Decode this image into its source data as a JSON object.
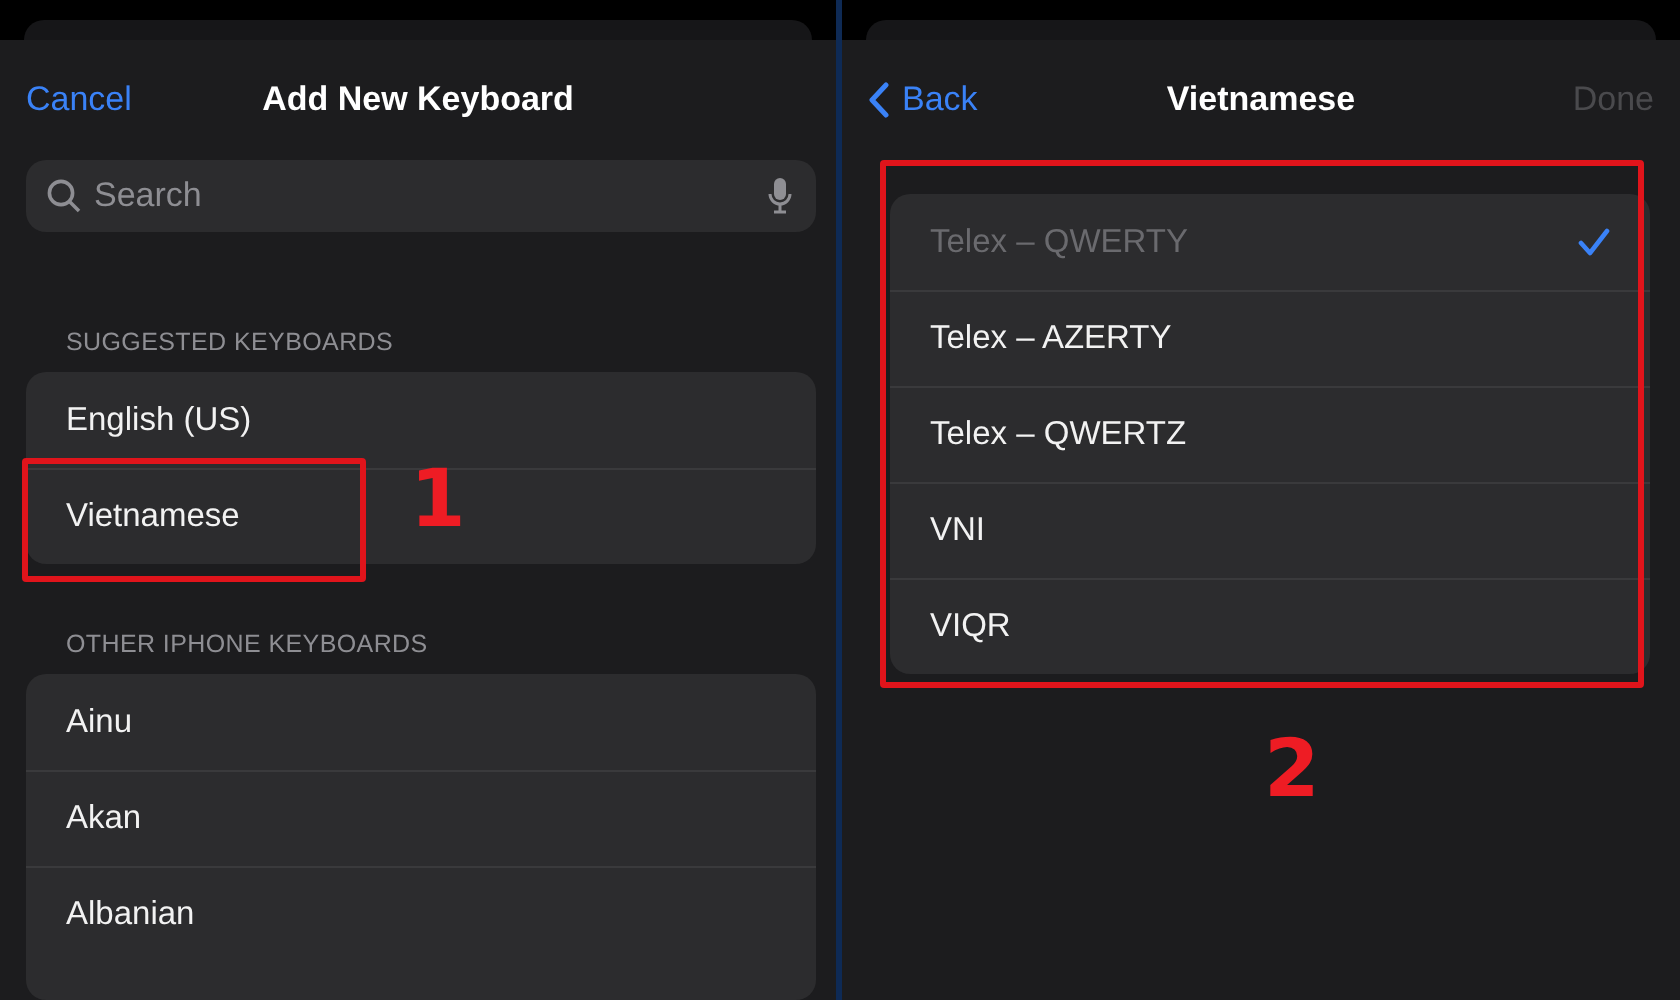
{
  "left": {
    "nav": {
      "cancel": "Cancel",
      "title": "Add New Keyboard"
    },
    "search": {
      "placeholder": "Search"
    },
    "sections": [
      {
        "header": "SUGGESTED KEYBOARDS",
        "items": [
          {
            "label": "English (US)",
            "highlighted": false
          },
          {
            "label": "Vietnamese",
            "highlighted": true
          }
        ]
      },
      {
        "header": "OTHER IPHONE KEYBOARDS",
        "items": [
          {
            "label": "Ainu",
            "highlighted": false
          },
          {
            "label": "Akan",
            "highlighted": false
          },
          {
            "label": "Albanian",
            "highlighted": false
          }
        ]
      }
    ],
    "annotation": "1"
  },
  "right": {
    "nav": {
      "back": "Back",
      "title": "Vietnamese",
      "done": "Done",
      "done_disabled": true
    },
    "highlighted": true,
    "layouts": [
      {
        "label": "Telex – QWERTY",
        "checked": true,
        "disabled": true
      },
      {
        "label": "Telex – AZERTY",
        "checked": false,
        "disabled": false
      },
      {
        "label": "Telex – QWERTZ",
        "checked": false,
        "disabled": false
      },
      {
        "label": "VNI",
        "checked": false,
        "disabled": false
      },
      {
        "label": "VIQR",
        "checked": false,
        "disabled": false
      }
    ],
    "annotation": "2"
  }
}
